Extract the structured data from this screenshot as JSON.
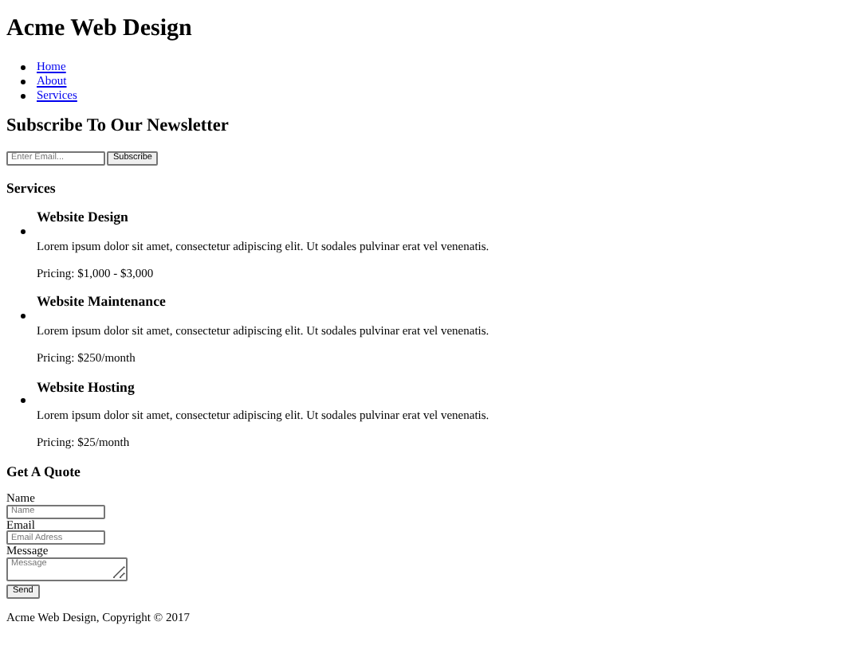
{
  "site_title": "Acme Web Design",
  "nav": [
    {
      "label": "Home"
    },
    {
      "label": "About"
    },
    {
      "label": "Services"
    }
  ],
  "newsletter": {
    "heading": "Subscribe To Our Newsletter",
    "placeholder": "Enter Email...",
    "button": "Subscribe"
  },
  "services": {
    "heading": "Services",
    "items": [
      {
        "title": "Website Design",
        "description": "Lorem ipsum dolor sit amet, consectetur adipiscing elit. Ut sodales pulvinar erat vel venenatis.",
        "pricing": "Pricing: $1,000 - $3,000"
      },
      {
        "title": "Website Maintenance",
        "description": "Lorem ipsum dolor sit amet, consectetur adipiscing elit. Ut sodales pulvinar erat vel venenatis.",
        "pricing": "Pricing: $250/month"
      },
      {
        "title": "Website Hosting",
        "description": "Lorem ipsum dolor sit amet, consectetur adipiscing elit. Ut sodales pulvinar erat vel venenatis.",
        "pricing": "Pricing: $25/month"
      }
    ]
  },
  "quote": {
    "heading": "Get A Quote",
    "fields": [
      {
        "kind": "input",
        "label": "Name",
        "placeholder": "Name"
      },
      {
        "kind": "input",
        "label": "Email",
        "placeholder": "Email Adress"
      },
      {
        "kind": "textarea",
        "label": "Message",
        "placeholder": "Message"
      }
    ],
    "button": "Send"
  },
  "footer": "Acme Web Design, Copyright © 2017"
}
